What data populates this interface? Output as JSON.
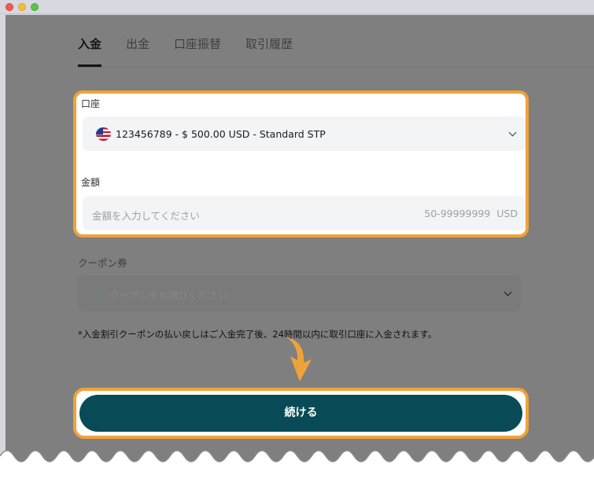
{
  "tabs": [
    {
      "label": "入金"
    },
    {
      "label": "出金"
    },
    {
      "label": "口座振替"
    },
    {
      "label": "取引履歴"
    }
  ],
  "account": {
    "label": "口座",
    "value": "123456789 - $ 500.00 USD - Standard STP",
    "flag_icon": "us-flag-icon"
  },
  "amount": {
    "label": "金額",
    "placeholder": "金額を入力してください",
    "range": "50-99999999",
    "currency": "USD"
  },
  "coupon": {
    "label": "クーポン券",
    "placeholder": "クーポンをお選びください"
  },
  "note": "*入金割引クーポンの払い戻しはご入金完了後、24時間以内に取引口座に入金されます。",
  "continue_label": "続ける",
  "colors": {
    "highlight": "#f0a23a",
    "primary_button": "#084b56",
    "overlay": "#7f7f7f"
  }
}
